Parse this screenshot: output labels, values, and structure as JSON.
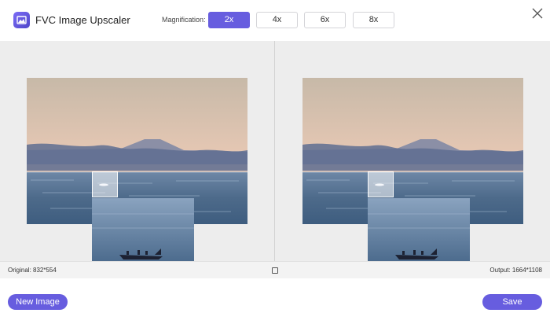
{
  "header": {
    "app_title": "FVC Image Upscaler",
    "magnification_label": "Magnification:",
    "magnification_options": [
      "2x",
      "4x",
      "6x",
      "8x"
    ],
    "selected_magnification": "2x"
  },
  "info": {
    "original": "Original: 832*554",
    "output": "Output: 1664*1108"
  },
  "footer": {
    "new_image_label": "New Image",
    "save_label": "Save"
  },
  "colors": {
    "accent": "#675ddf",
    "workspace_bg": "#ededed"
  },
  "icons": {
    "logo": "image-icon",
    "close": "close-icon",
    "compare": "compare-icon"
  }
}
